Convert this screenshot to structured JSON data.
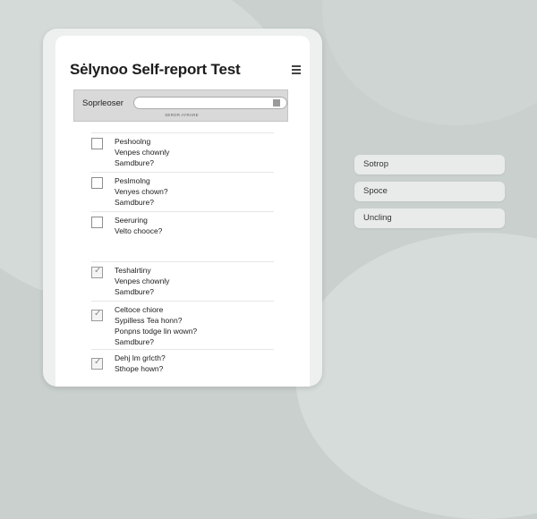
{
  "app": {
    "title": "Sėlynoo Self-report Test"
  },
  "icons": {
    "menu": "hamburger-menu-icon",
    "search": "search-icon",
    "check": "checkmark-icon"
  },
  "search": {
    "label": "Soprleoser",
    "value": "",
    "placeholder": "",
    "hint": "SEROR AYRARE"
  },
  "questions": [
    {
      "lines": [
        "Peshoolng",
        "Venpes chownly",
        "Samdbure?"
      ],
      "checked": false
    },
    {
      "lines": [
        "Peslmolng",
        "Venyes chown?",
        "Samdbure?"
      ],
      "checked": false
    },
    {
      "lines": [
        "Seeruring",
        "Velto chooce?"
      ],
      "checked": false
    },
    {
      "lines": [
        "Teshalrtiny",
        "Venpes chownly",
        "Samdbure?"
      ],
      "checked": true
    },
    {
      "lines": [
        "Celtoce chiore",
        "Sypilless Tea honn?",
        "Ponpns todge lin wown?",
        "Samdbure?"
      ],
      "checked": true
    },
    {
      "lines": [
        "Dehj lm grlcth?",
        "Sthope hown?"
      ],
      "checked": true
    }
  ],
  "side_buttons": [
    "Sotrop",
    "Spoce",
    "Uncling"
  ],
  "colors": {
    "background": "#c9d0cd",
    "card": "#ffffff",
    "search_bar": "#d9d9d9"
  }
}
